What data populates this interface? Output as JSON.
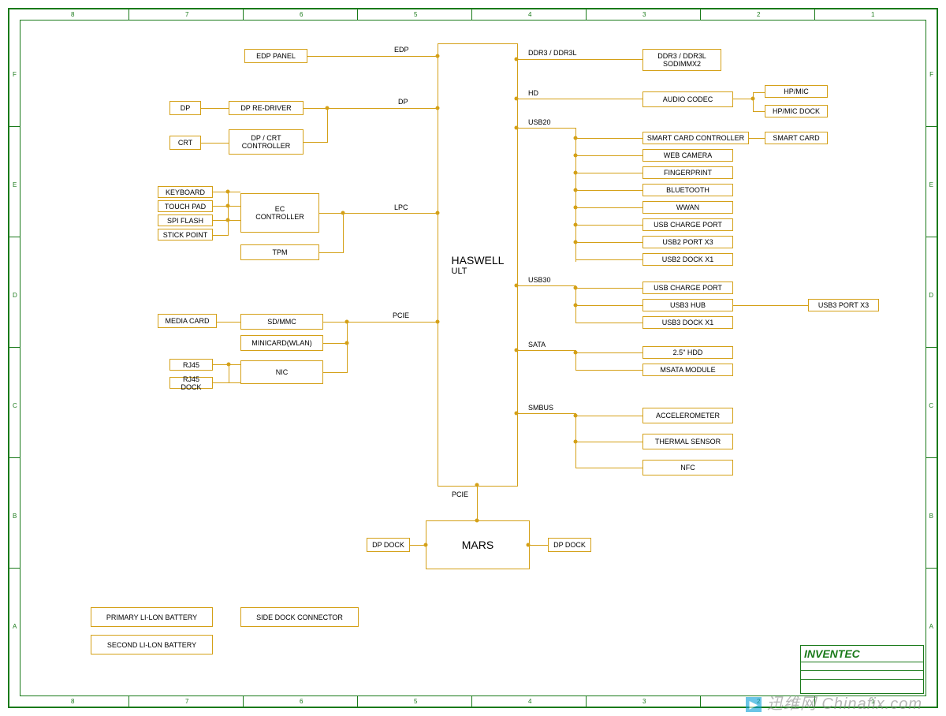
{
  "frame": {
    "top_numbers": [
      "8",
      "7",
      "6",
      "5",
      "4",
      "3",
      "2",
      "1"
    ],
    "bottom_numbers": [
      "8",
      "7",
      "6",
      "5",
      "4",
      "3",
      "2",
      "1"
    ],
    "side_letters": [
      "F",
      "E",
      "D",
      "C",
      "B",
      "A"
    ]
  },
  "cpu": {
    "title": "HASWELL",
    "sub": "ULT"
  },
  "south": {
    "title": "MARS"
  },
  "left_boxes": {
    "edp_panel": "EDP PANEL",
    "dp": "DP",
    "dp_redriver": "DP RE-DRIVER",
    "crt": "CRT",
    "dp_crt_ctrl": "DP / CRT\nCONTROLLER",
    "keyboard": "KEYBOARD",
    "touchpad": "TOUCH PAD",
    "spiflash": "SPI FLASH",
    "stickpoint": "STICK POINT",
    "ec": "EC\nCONTROLLER",
    "tpm": "TPM",
    "media": "MEDIA CARD",
    "sdmmc": "SD/MMC",
    "minicard": "MINICARD(WLAN)",
    "rj45": "RJ45",
    "rj45dock": "RJ45 DOCK",
    "nic": "NIC"
  },
  "right_boxes": {
    "ddr": "DDR3 / DDR3L\nSODIMMX2",
    "audio": "AUDIO CODEC",
    "hpmic": "HP/MIC",
    "hpmic_dock": "HP/MIC DOCK",
    "smartcard_ctrl": "SMART CARD CONTROLLER",
    "smartcard": "SMART CARD",
    "webcam": "WEB CAMERA",
    "fingerprint": "FINGERPRINT",
    "bt": "BLUETOOTH",
    "wwan": "WWAN",
    "usbcharge1": "USB CHARGE PORT",
    "usb2x3": "USB2 PORT X3",
    "usb2dock": "USB2 DOCK X1",
    "usbcharge2": "USB CHARGE PORT",
    "usb3hub": "USB3 HUB",
    "usb3dock": "USB3 DOCK X1",
    "usb3port": "USB3 PORT X3",
    "hdd": "2.5\" HDD",
    "msata": "MSATA MODULE",
    "accel": "ACCELEROMETER",
    "thermal": "THERMAL SENSOR",
    "nfc": "NFC"
  },
  "mars_io": {
    "dp_dock_l": "DP DOCK",
    "dp_dock_r": "DP DOCK"
  },
  "standalone": {
    "primary_bat": "PRIMARY LI-LON BATTERY",
    "second_bat": "SECOND LI-LON BATTERY",
    "sidedock": "SIDE DOCK CONNECTOR"
  },
  "bus_labels": {
    "edp": "EDP",
    "dp": "DP",
    "lpc": "LPC",
    "pcie": "PCIE",
    "pcie2": "PCIE",
    "ddr": "DDR3 / DDR3L",
    "hd": "HD",
    "usb20": "USB20",
    "usb30": "USB30",
    "sata": "SATA",
    "smbus": "SMBUS"
  },
  "title_block": {
    "company": "INVENTEC"
  },
  "watermark": {
    "brand": "迅维网",
    "site": "Chinafix.com"
  }
}
